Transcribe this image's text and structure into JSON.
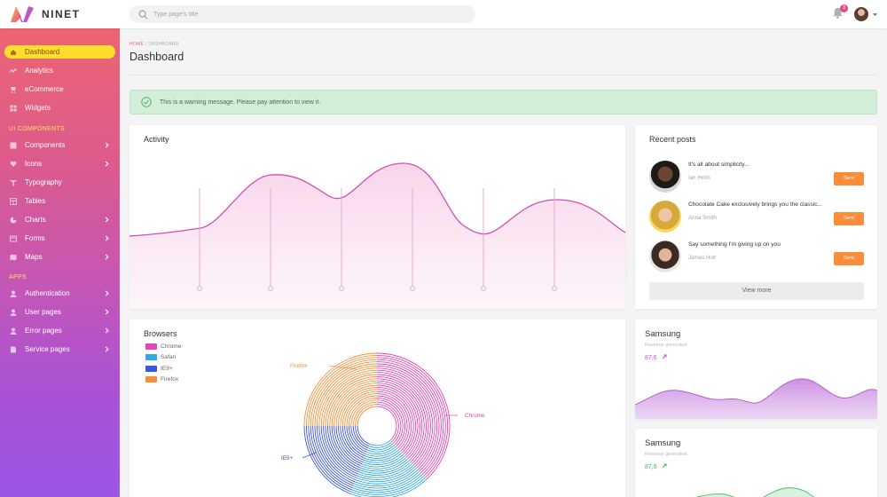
{
  "brand": {
    "name": "NINET"
  },
  "search": {
    "placeholder": "Type page's title"
  },
  "notifications": {
    "count": "3"
  },
  "sidebar": {
    "items": [
      {
        "label": "Dashboard",
        "icon": "home-icon",
        "active": true
      },
      {
        "label": "Analytics",
        "icon": "analytics-icon"
      },
      {
        "label": "eCommerce",
        "icon": "cart-icon"
      },
      {
        "label": "Widgets",
        "icon": "widgets-icon"
      }
    ],
    "section_ui": "UI COMPONENTS",
    "ui_items": [
      {
        "label": "Components",
        "icon": "components-icon",
        "chevron": true
      },
      {
        "label": "Icons",
        "icon": "icons-icon",
        "chevron": true
      },
      {
        "label": "Typography",
        "icon": "typography-icon"
      },
      {
        "label": "Tables",
        "icon": "tables-icon"
      },
      {
        "label": "Charts",
        "icon": "charts-icon",
        "chevron": true
      },
      {
        "label": "Forms",
        "icon": "forms-icon",
        "chevron": true
      },
      {
        "label": "Maps",
        "icon": "maps-icon",
        "chevron": true
      }
    ],
    "section_apps": "APPS",
    "app_items": [
      {
        "label": "Authentication",
        "icon": "user-icon",
        "chevron": true
      },
      {
        "label": "User pages",
        "icon": "user-icon",
        "chevron": true
      },
      {
        "label": "Error pages",
        "icon": "user-icon",
        "chevron": true
      },
      {
        "label": "Service pages",
        "icon": "document-icon",
        "chevron": true
      }
    ]
  },
  "breadcrumb": {
    "home": "HOME",
    "separator": "/",
    "current": "DASHBOARD"
  },
  "page": {
    "title": "Dashboard"
  },
  "alert": {
    "text": "This is a warning message. Please pay attention to view it."
  },
  "activity": {
    "title": "Activity"
  },
  "recent_posts": {
    "title": "Recent posts",
    "posts": [
      {
        "title": "It's all about simplicity...",
        "author": "Ian Holm",
        "button": "Sent"
      },
      {
        "title": "Chocolate Cake exclusively brings you the classic...",
        "author": "Anna Smith",
        "button": "Sent"
      },
      {
        "title": "Say something I'm giving up on you",
        "author": "James Holt",
        "button": "Sent"
      }
    ],
    "view_more": "View more"
  },
  "browsers": {
    "title": "Browsers",
    "legend": [
      {
        "label": "Chrome",
        "color": "#e844b4"
      },
      {
        "label": "Safari",
        "color": "#2fa8e8"
      },
      {
        "label": "IE9+",
        "color": "#3c55dc"
      },
      {
        "label": "Firefox",
        "color": "#f7903a"
      }
    ],
    "labels": {
      "chrome": "Chrome",
      "firefox": "Firefox",
      "ie": "IE9+"
    }
  },
  "samsung1": {
    "title": "Samsung",
    "subtitle": "Revenue generated",
    "value": "87,6",
    "value_color": "#c04fd0"
  },
  "samsung2": {
    "title": "Samsung",
    "subtitle": "Revenue generated",
    "value": "87,6",
    "value_color": "#3cba5c"
  },
  "colors": {
    "accent": "#e9608c",
    "active": "#ffde2b",
    "button": "#fb8c3a"
  },
  "chart_data": [
    {
      "type": "pie",
      "categories": [
        "Chrome",
        "Safari",
        "IE9+",
        "Firefox"
      ],
      "values": [
        38,
        18,
        19,
        25
      ]
    }
  ]
}
